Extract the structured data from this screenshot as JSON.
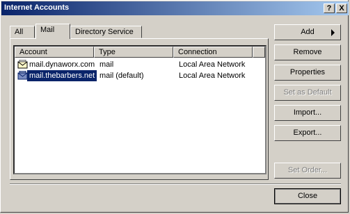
{
  "window": {
    "title": "Internet Accounts"
  },
  "titlebar_buttons": {
    "help_label": "?",
    "close_label": "X"
  },
  "tabs": [
    "All",
    "Mail",
    "Directory Service"
  ],
  "active_tab": "Mail",
  "list": {
    "columns": [
      "Account",
      "Type",
      "Connection"
    ],
    "rows": [
      {
        "account": "mail.dynaworx.com",
        "type": "mail",
        "connection": "Local Area Network",
        "selected": false
      },
      {
        "account": "mail.thebarbers.net",
        "type": "mail (default)",
        "connection": "Local Area Network",
        "selected": true
      }
    ]
  },
  "buttons": {
    "add": "Add",
    "remove": "Remove",
    "properties": "Properties",
    "set_default": "Set as Default",
    "import": "Import...",
    "export": "Export...",
    "set_order": "Set Order...",
    "close": "Close"
  }
}
